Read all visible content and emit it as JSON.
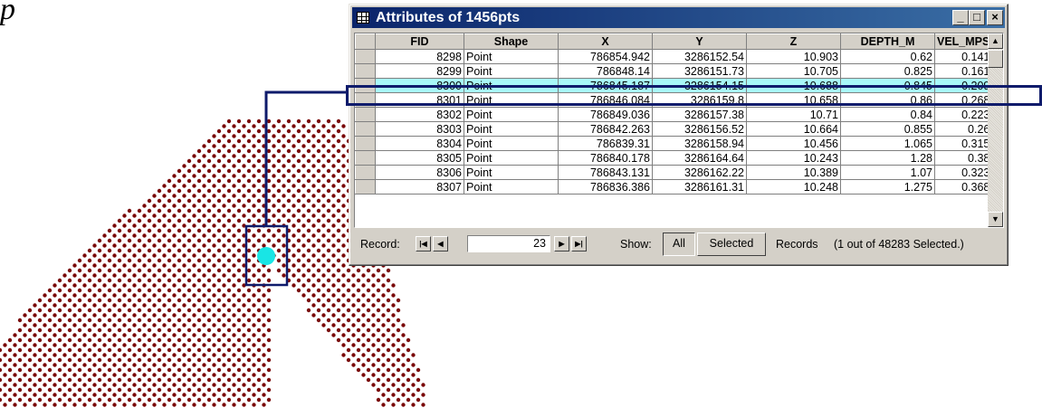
{
  "caption": "p",
  "window": {
    "title": "Attributes of 1456pts",
    "controls": {
      "minimize": "_",
      "maximize": "□",
      "close": "×"
    }
  },
  "table": {
    "columns": [
      "FID",
      "Shape",
      "X",
      "Y",
      "Z",
      "DEPTH_M",
      "VEL_MPS"
    ],
    "rows": [
      [
        "8298",
        "Point",
        "786854.942",
        "3286152.54",
        "10.903",
        "0.62",
        "0.141"
      ],
      [
        "8299",
        "Point",
        "786848.14",
        "3286151.73",
        "10.705",
        "0.825",
        "0.161"
      ],
      [
        "8300",
        "Point",
        "786845.187",
        "3286154.15",
        "10.688",
        "0.845",
        "0.209"
      ],
      [
        "8301",
        "Point",
        "786846.084",
        "3286159.8",
        "10.658",
        "0.86",
        "0.268"
      ],
      [
        "8302",
        "Point",
        "786849.036",
        "3286157.38",
        "10.71",
        "0.84",
        "0.223"
      ],
      [
        "8303",
        "Point",
        "786842.263",
        "3286156.52",
        "10.664",
        "0.855",
        "0.26"
      ],
      [
        "8304",
        "Point",
        "786839.31",
        "3286158.94",
        "10.456",
        "1.065",
        "0.315"
      ],
      [
        "8305",
        "Point",
        "786840.178",
        "3286164.64",
        "10.243",
        "1.28",
        "0.38"
      ],
      [
        "8306",
        "Point",
        "786843.131",
        "3286162.22",
        "10.389",
        "1.07",
        "0.323"
      ],
      [
        "8307",
        "Point",
        "786836.386",
        "3286161.31",
        "10.248",
        "1.275",
        "0.368"
      ]
    ],
    "selected_fid": "8300"
  },
  "footer": {
    "record_label": "Record:",
    "record_value": "23",
    "show_label": "Show:",
    "all_button": "All",
    "selected_button": "Selected",
    "records_label": "Records",
    "selection_status": "(1 out of 48283 Selected.)"
  },
  "icons": {
    "first": "first-record-icon",
    "prev": "previous-record-icon",
    "next": "next-record-icon",
    "last": "last-record-icon",
    "scroll_up": "scroll-up-icon",
    "scroll_down": "scroll-down-icon"
  },
  "colors": {
    "point": "#7a0a0a",
    "selected_point": "#19e5e5",
    "selected_row": "#a8f8f8",
    "highlight_box": "#0f1b6b",
    "titlebar": "#0a246a"
  }
}
